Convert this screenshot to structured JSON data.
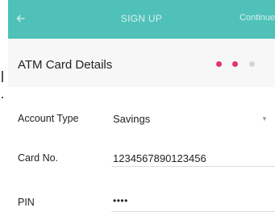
{
  "navbar": {
    "back_icon": "arrow-left-icon",
    "title": "SIGN UP",
    "continue_label": "Continue",
    "color": "#4fc1b9"
  },
  "section": {
    "title": "ATM Card Details",
    "step_dots": {
      "total": 3,
      "active": 2,
      "active_color": "#e0366a",
      "inactive_color": "#d4d4d4"
    }
  },
  "form": {
    "fields": [
      {
        "label": "Account Type",
        "value": "Savings",
        "control": "dropdown",
        "icon": "caret-down-icon"
      },
      {
        "label": "Card No.",
        "value": "1234567890123456",
        "control": "text"
      },
      {
        "label": "PIN",
        "value": "••••",
        "control": "password"
      }
    ]
  }
}
